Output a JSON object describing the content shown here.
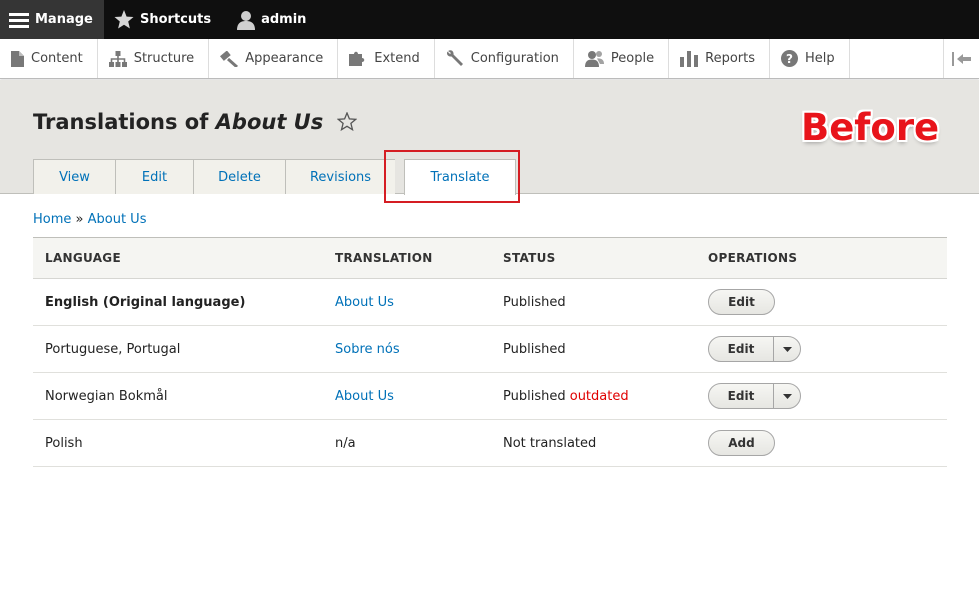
{
  "toolbar": {
    "manage": "Manage",
    "shortcuts": "Shortcuts",
    "user": "admin"
  },
  "tray": {
    "items": [
      {
        "label": "Content",
        "icon": "file-icon"
      },
      {
        "label": "Structure",
        "icon": "sitemap-icon"
      },
      {
        "label": "Appearance",
        "icon": "paint-icon"
      },
      {
        "label": "Extend",
        "icon": "puzzle-icon"
      },
      {
        "label": "Configuration",
        "icon": "wrench-icon"
      },
      {
        "label": "People",
        "icon": "people-icon"
      },
      {
        "label": "Reports",
        "icon": "bar-chart-icon"
      },
      {
        "label": "Help",
        "icon": "help-icon"
      }
    ]
  },
  "header": {
    "title_prefix": "Translations of ",
    "title_node": "About Us",
    "annotation": "Before"
  },
  "tabs": [
    {
      "label": "View"
    },
    {
      "label": "Edit"
    },
    {
      "label": "Delete"
    },
    {
      "label": "Revisions"
    },
    {
      "label": "Translate",
      "active": true
    }
  ],
  "breadcrumb": {
    "home": "Home",
    "separator": " » ",
    "current": "About Us"
  },
  "table": {
    "headers": [
      "LANGUAGE",
      "TRANSLATION",
      "STATUS",
      "OPERATIONS"
    ],
    "rows": [
      {
        "language": "English (Original language)",
        "translation": "About Us",
        "status": "Published",
        "status_note": "",
        "operation": "Edit"
      },
      {
        "language": "Portuguese, Portugal",
        "translation": "Sobre nós",
        "status": "Published",
        "status_note": "",
        "operation": "Edit"
      },
      {
        "language": "Norwegian Bokmål",
        "translation": "About Us",
        "status": "Published ",
        "status_note": "outdated",
        "operation": "Edit"
      },
      {
        "language": "Polish",
        "translation": "n/a",
        "status": "Not translated",
        "status_note": "",
        "operation": "Add"
      }
    ]
  },
  "colors": {
    "link": "#0071b8",
    "annotation": "#e8141b",
    "outdated": "#e00000"
  }
}
